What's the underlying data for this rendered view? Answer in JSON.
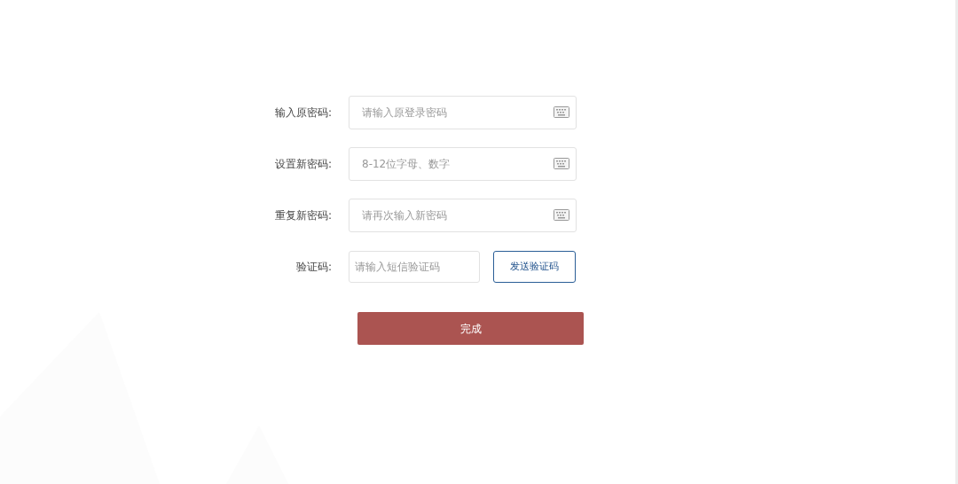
{
  "password_fields": [
    {
      "label": "输入原密码:",
      "placeholder": "请输入原登录密码"
    },
    {
      "label": "设置新密码:",
      "placeholder": "8-12位字母、数字"
    },
    {
      "label": "重复新密码:",
      "placeholder": "请再次输入新密码"
    }
  ],
  "verification": {
    "label": "验证码:",
    "placeholder": "请输入短信验证码",
    "send_button": "发送验证码"
  },
  "submit_button": "完成"
}
